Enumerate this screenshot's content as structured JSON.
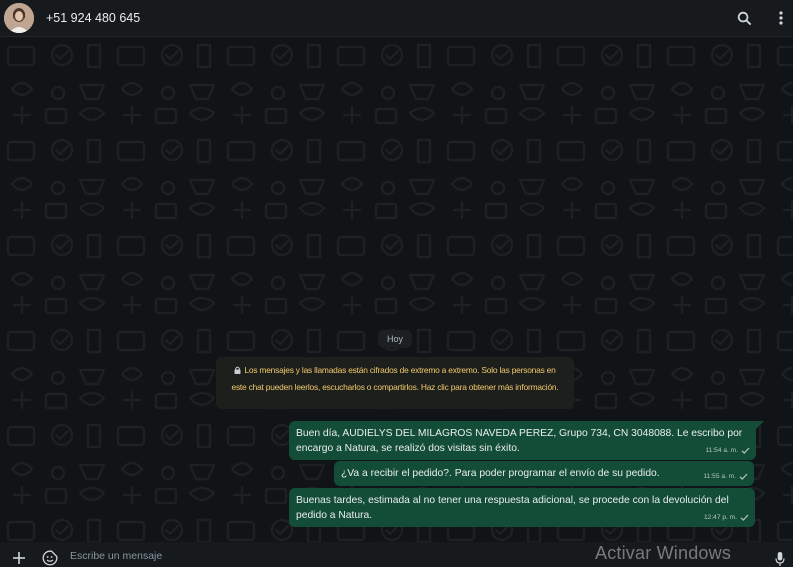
{
  "header": {
    "contact_name": "+51 924 480 645",
    "avatar_icon": "contact-avatar",
    "search_icon": "search-icon",
    "menu_icon": "more-vertical-icon"
  },
  "chat": {
    "day_label": "Hoy",
    "encryption_notice": "Los mensajes y las llamadas están cifrados de extremo a extremo. Solo las personas en este chat pueden leerlos, escucharlos o compartirlos. Haz clic para obtener más información.",
    "encryption_color": "#f2c96b",
    "messages": [
      {
        "text": "Buen día, AUDIELYS DEL MILAGROS NAVEDA PEREZ, Grupo 734, CN 3048088. Le escribo por encargo a Natura, se realizó dos visitas sin éxito.",
        "time": "11:54 a. m.",
        "status": "sent"
      },
      {
        "text": "¿Va a recibir el pedido?. Para poder programar el envío de su pedido.",
        "time": "11:55 a. m.",
        "status": "sent"
      },
      {
        "text": "Buenas tardes, estimada al no tener una respuesta adicional, se procede con la devolución del pedido a Natura.",
        "time": "12:47 p. m.",
        "status": "sent"
      }
    ],
    "outgoing_bubble_color": "#144d37"
  },
  "composer": {
    "placeholder": "Escribe un mensaje",
    "attach_icon": "plus-icon",
    "emoji_icon": "sticker-icon",
    "mic_icon": "microphone-icon"
  },
  "watermark": {
    "text": "Activar Windows"
  }
}
